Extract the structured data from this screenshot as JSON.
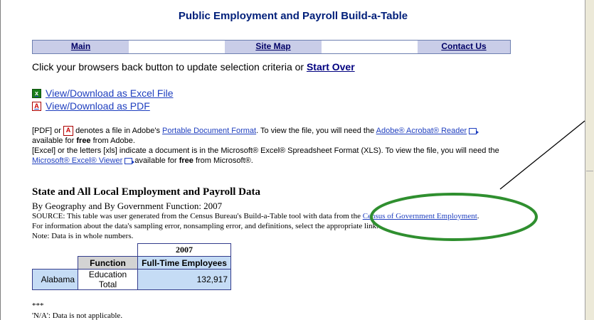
{
  "header": {
    "title": "Public Employment and Payroll Build-a-Table"
  },
  "nav": {
    "main": "Main",
    "site_map": "Site Map",
    "contact_us": "Contact Us"
  },
  "back": {
    "text": "Click your browsers back button to update selection criteria or ",
    "start_over": "Start Over"
  },
  "downloads": {
    "excel": "View/Download as Excel File",
    "pdf": "View/Download as PDF"
  },
  "notes": {
    "pdf_pre": "[PDF] or ",
    "pdf_mid": " denotes a file in Adobe's ",
    "pdf_link": "Portable Document Format",
    "pdf_mid2": ". To view the file, you will need the ",
    "acrobat_link": "Adobe® Acrobat® Reader",
    "pdf_post_a": " available for ",
    "free": "free",
    "pdf_post_b": " from Adobe.",
    "excel_pre": "[Excel] or the letters [xls] indicate a document is in the Microsoft® Excel® Spreadsheet Format (XLS). To view the file, you will need the ",
    "excel_link": "Microsoft® Excel® Viewer",
    "excel_post_a": " available for ",
    "excel_post_b": " from Microsoft®."
  },
  "report": {
    "heading": "State and All Local Employment and Payroll Data",
    "subheading": "By Geography and By Government Function: 2007",
    "source_pre": "SOURCE: This table was user generated from the Census Bureau's Build-a-Table tool with data from the ",
    "source_link": "Census of Government Employment",
    "source_post": ".",
    "info": "For information about the data's sampling error, nonsampling error, and definitions, select the appropriate link.",
    "note": "Note: Data is in whole numbers."
  },
  "table": {
    "year": "2007",
    "function_header": "Function",
    "column_header": "Full-Time Employees",
    "rows": [
      {
        "state": "Alabama",
        "function": "Education Total",
        "value": "132,917"
      }
    ]
  },
  "footer": {
    "stars": "***",
    "na_note": "'N/A': Data is not applicable."
  },
  "colors": {
    "title": "#001f7a",
    "nav_bg": "#c9cde8",
    "link": "#1f3fbf",
    "annotation_ellipse": "#2f8f2f",
    "table_blue": "#c5dcf5"
  }
}
